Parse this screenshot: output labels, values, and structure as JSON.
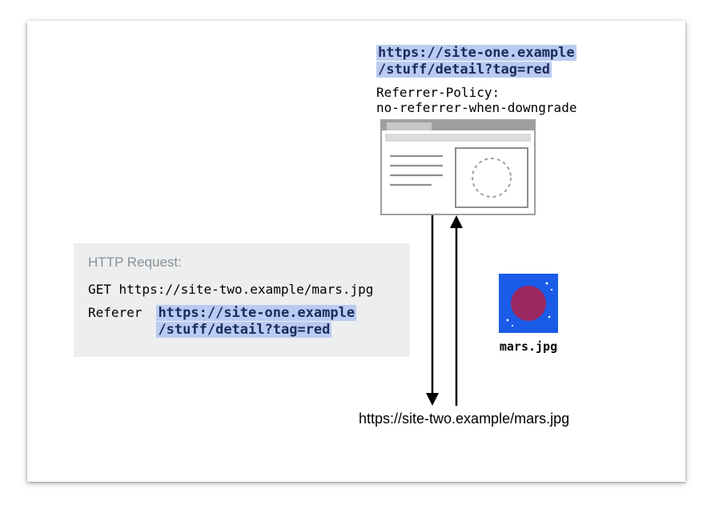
{
  "topUrl": {
    "line1": "https://site-one.example",
    "line2": "/stuff/detail?tag=red"
  },
  "policy": {
    "line1": "Referrer-Policy:",
    "line2": "no-referrer-when-downgrade"
  },
  "request": {
    "title": "HTTP Request:",
    "getLine": "GET https://site-two.example/mars.jpg",
    "refererLabel": "Referer",
    "refererVal": {
      "line1": "https://site-one.example",
      "line2": "/stuff/detail?tag=red"
    }
  },
  "mars": {
    "label": "mars.jpg"
  },
  "bottomUrl": "https://site-two.example/mars.jpg"
}
